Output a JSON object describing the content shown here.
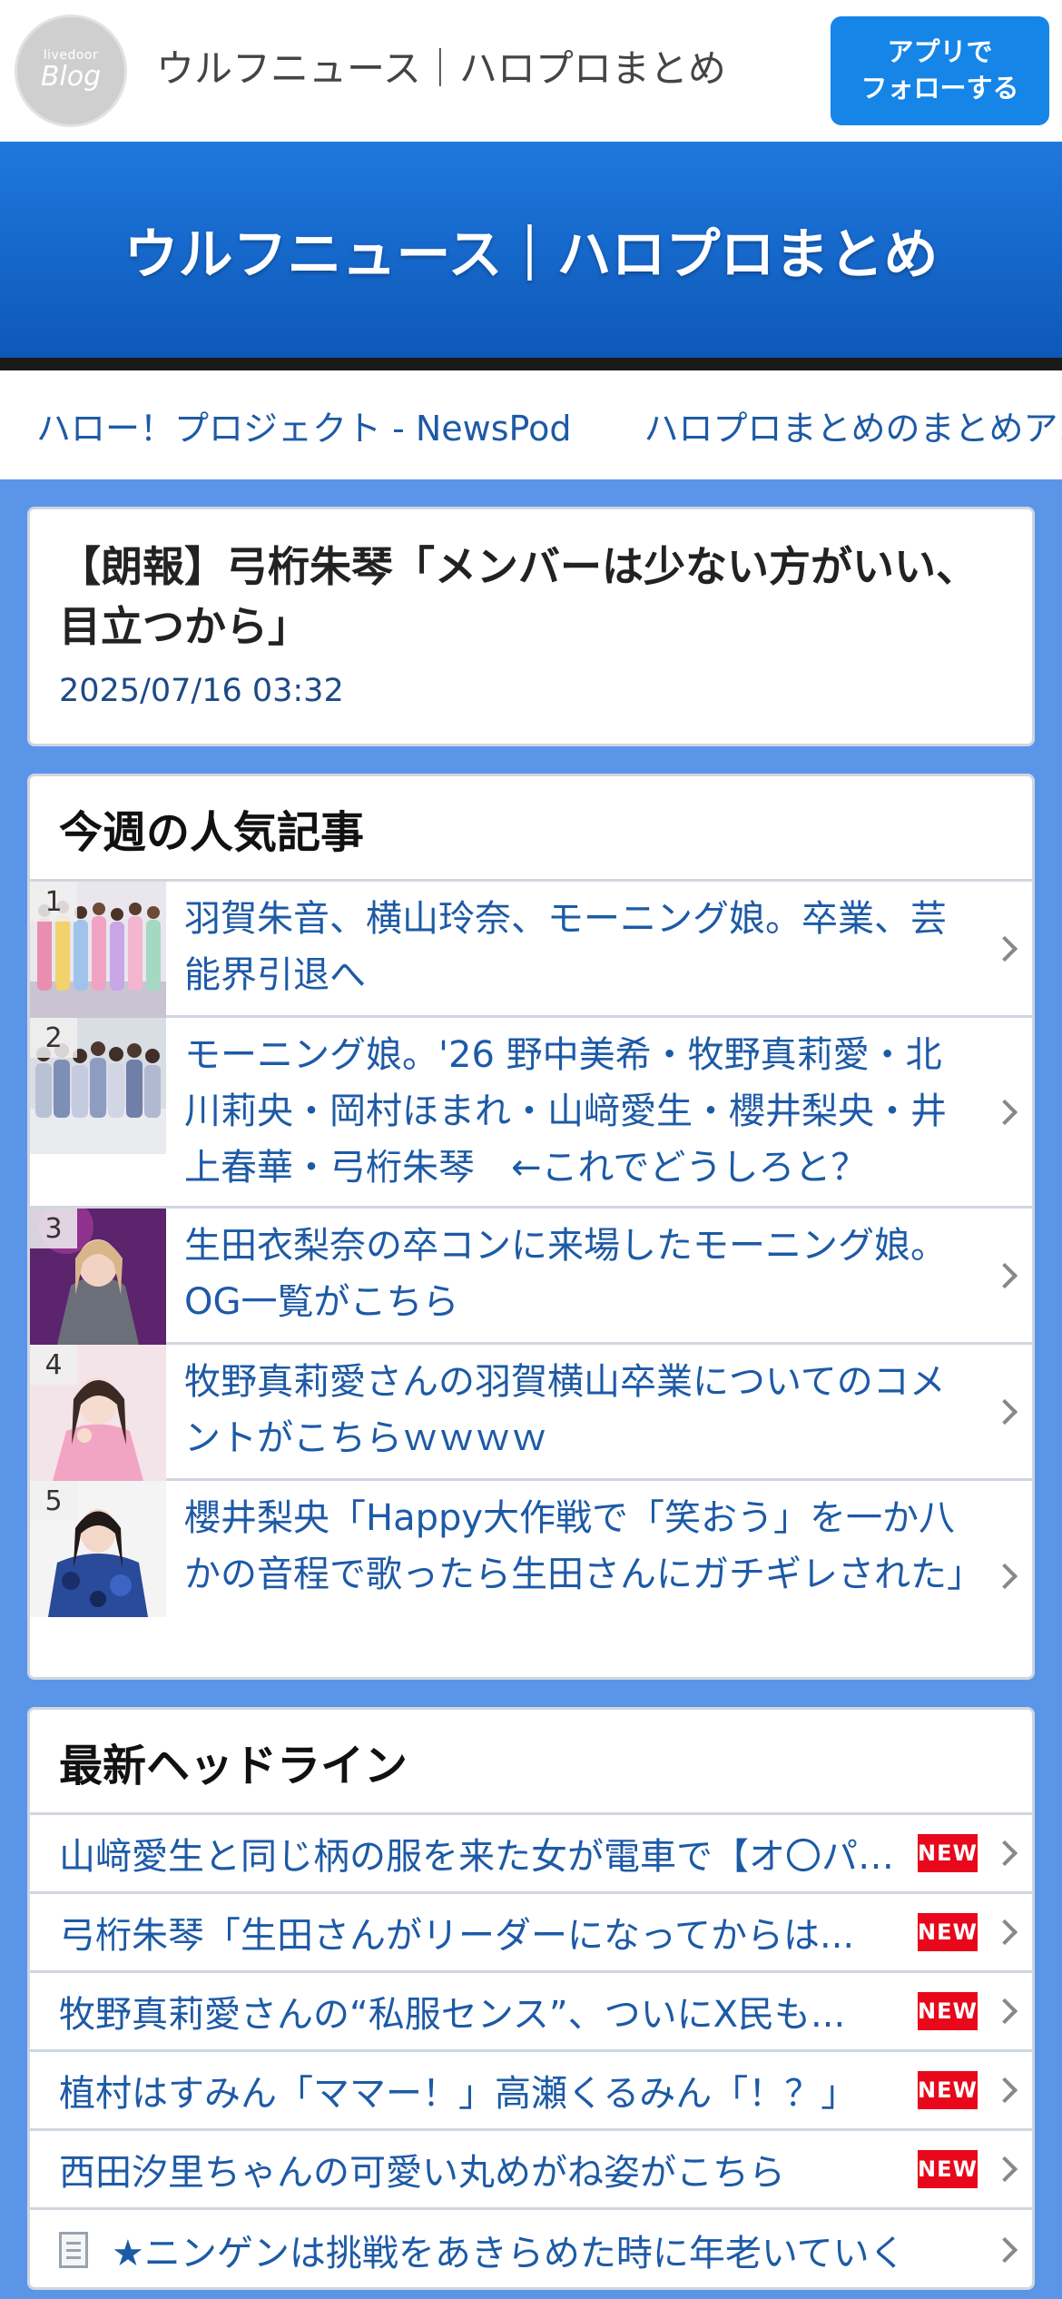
{
  "header": {
    "logo_small": "livedoor",
    "logo_big": "Blog",
    "site_title": "ウルフニュース｜ハロプロまとめ",
    "follow_line1": "アプリで",
    "follow_line2": "フォローする"
  },
  "hero": {
    "title": "ウルフニュース｜ハロプロまとめ"
  },
  "links_strip": [
    "ハロー！プロジェクト - NewsPod",
    "ハロプロまとめのまとめアン"
  ],
  "article": {
    "title": "【朗報】弓桁朱琴「メンバーは少ない方がいい、目立つから」",
    "date": "2025/07/16 03:32"
  },
  "popular": {
    "heading": "今週の人気記事",
    "items": [
      {
        "rank": "1",
        "title": "羽賀朱音、横山玲奈、モーニング娘。卒業、芸能界引退へ"
      },
      {
        "rank": "2",
        "title": "モーニング娘。'26 野中美希・牧野真莉愛・北川莉央・岡村ほまれ・山﨑愛生・櫻井梨央・井上春華・弓桁朱琴　←これでどうしろと？"
      },
      {
        "rank": "3",
        "title": "生田衣梨奈の卒コンに来場したモーニング娘。OG一覧がこちら"
      },
      {
        "rank": "4",
        "title": "牧野真莉愛さんの羽賀横山卒業についてのコメントがこちらｗｗｗｗ"
      },
      {
        "rank": "5",
        "title": "櫻井梨央「Happy大作戦で「笑おう」を一か八かの音程で歌ったら生田さんにガチギレされた」"
      }
    ]
  },
  "headlines": {
    "heading": "最新ヘッドライン",
    "new_label": "NEW",
    "items": [
      {
        "title": "山﨑愛生と同じ柄の服を来た女が電車で【オ〇パイ】"
      },
      {
        "title": "弓桁朱琴「生田さんがリーダーになってからは..."
      },
      {
        "title": "牧野真莉愛さんの“私服センス”、ついにX民も..."
      },
      {
        "title": "植村はすみん「ママー！」高瀬くるみん「！？」"
      },
      {
        "title": "西田汐里ちゃんの可愛い丸めがね姿がこちら"
      },
      {
        "title": "★ニンゲンは挑戦をあきらめた時に年老いていく"
      }
    ]
  },
  "colors": {
    "page_bg": "#5b95e8",
    "hero_blue": "#1f78de",
    "follow_button": "#1585e8",
    "link_blue": "#1d5aa6",
    "new_badge": "#e8071b"
  }
}
